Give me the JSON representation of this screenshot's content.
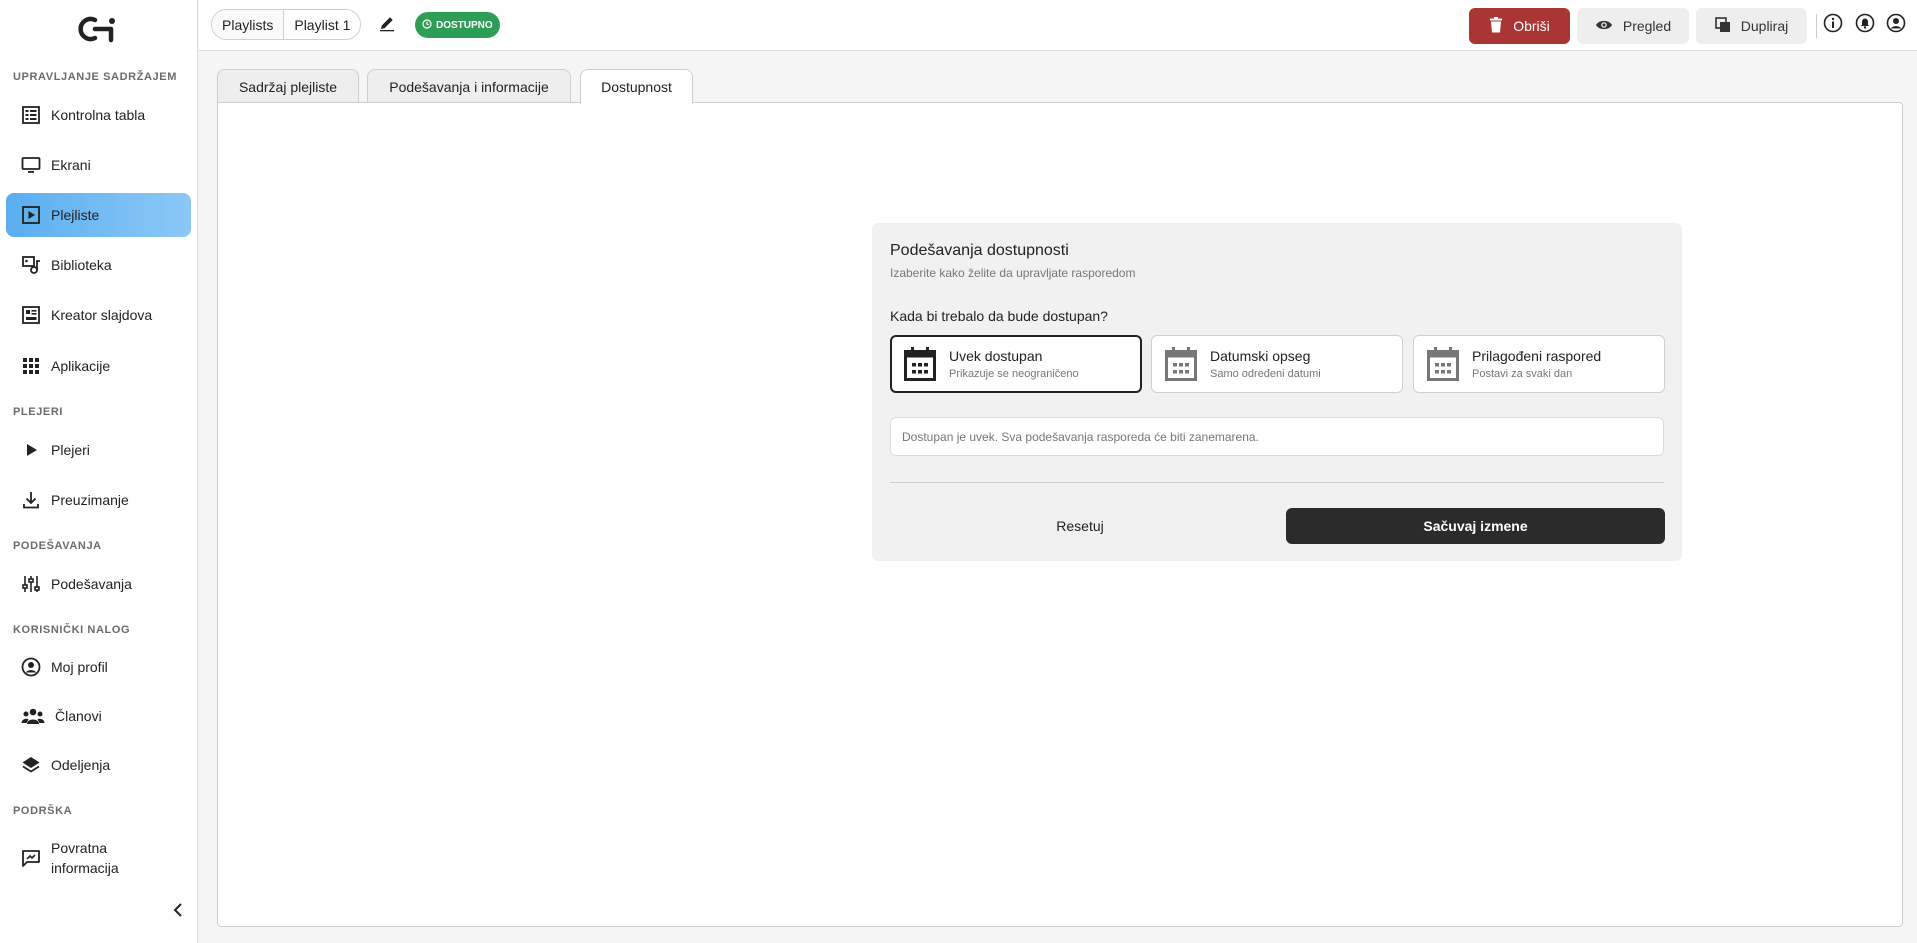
{
  "sidebar": {
    "sections": {
      "content": "UPRAVLJANJE SADRŽAJEM",
      "players": "PLEJERI",
      "settings": "PODEŠAVANJA",
      "account": "KORISNIČKI NALOG",
      "support": "PODRŠKA"
    },
    "items": [
      {
        "label": "Kontrolna tabla",
        "icon": "dashboard-icon"
      },
      {
        "label": "Ekrani",
        "icon": "monitor-icon"
      },
      {
        "label": "Plejliste",
        "icon": "playlist-icon",
        "active": true
      },
      {
        "label": "Biblioteka",
        "icon": "media-library-icon"
      },
      {
        "label": "Kreator slajdova",
        "icon": "slide-creator-icon"
      },
      {
        "label": "Aplikacije",
        "icon": "apps-grid-icon"
      },
      {
        "label": "Plejeri",
        "icon": "play-icon"
      },
      {
        "label": "Preuzimanje",
        "icon": "download-icon"
      },
      {
        "label": "Podešavanja",
        "icon": "sliders-icon"
      },
      {
        "label": "Moj profil",
        "icon": "profile-icon"
      },
      {
        "label": "Članovi",
        "icon": "members-icon"
      },
      {
        "label": "Odeljenja",
        "icon": "layers-icon"
      },
      {
        "label": "Povratna informacija",
        "icon": "feedback-icon"
      }
    ]
  },
  "header": {
    "breadcrumb": [
      "Playlists",
      "Playlist 1"
    ],
    "status": "DOSTUPNO",
    "status_color": "#2e9e57",
    "buttons": {
      "delete": "Obriši",
      "preview": "Pregled",
      "duplicate": "Dupliraj"
    },
    "delete_color": "#a93535"
  },
  "tabs": [
    {
      "label": "Sadržaj plejliste"
    },
    {
      "label": "Podešavanja i informacije"
    },
    {
      "label": "Dostupnost",
      "active": true
    }
  ],
  "availability": {
    "title": "Podešavanja dostupnosti",
    "subtitle": "Izaberite kako želite da upravljate rasporedom",
    "question": "Kada bi trebalo da bude dostupan?",
    "options": [
      {
        "title": "Uvek dostupan",
        "desc": "Prikazuje se neograničeno",
        "selected": true
      },
      {
        "title": "Datumski opseg",
        "desc": "Samo određeni datumi"
      },
      {
        "title": "Prilagođeni raspored",
        "desc": "Postavi za svaki dan"
      }
    ],
    "info": "Dostupan je uvek. Sva podešavanja rasporeda će biti zanemarena.",
    "reset": "Resetuj",
    "save": "Sačuvaj izmene"
  }
}
